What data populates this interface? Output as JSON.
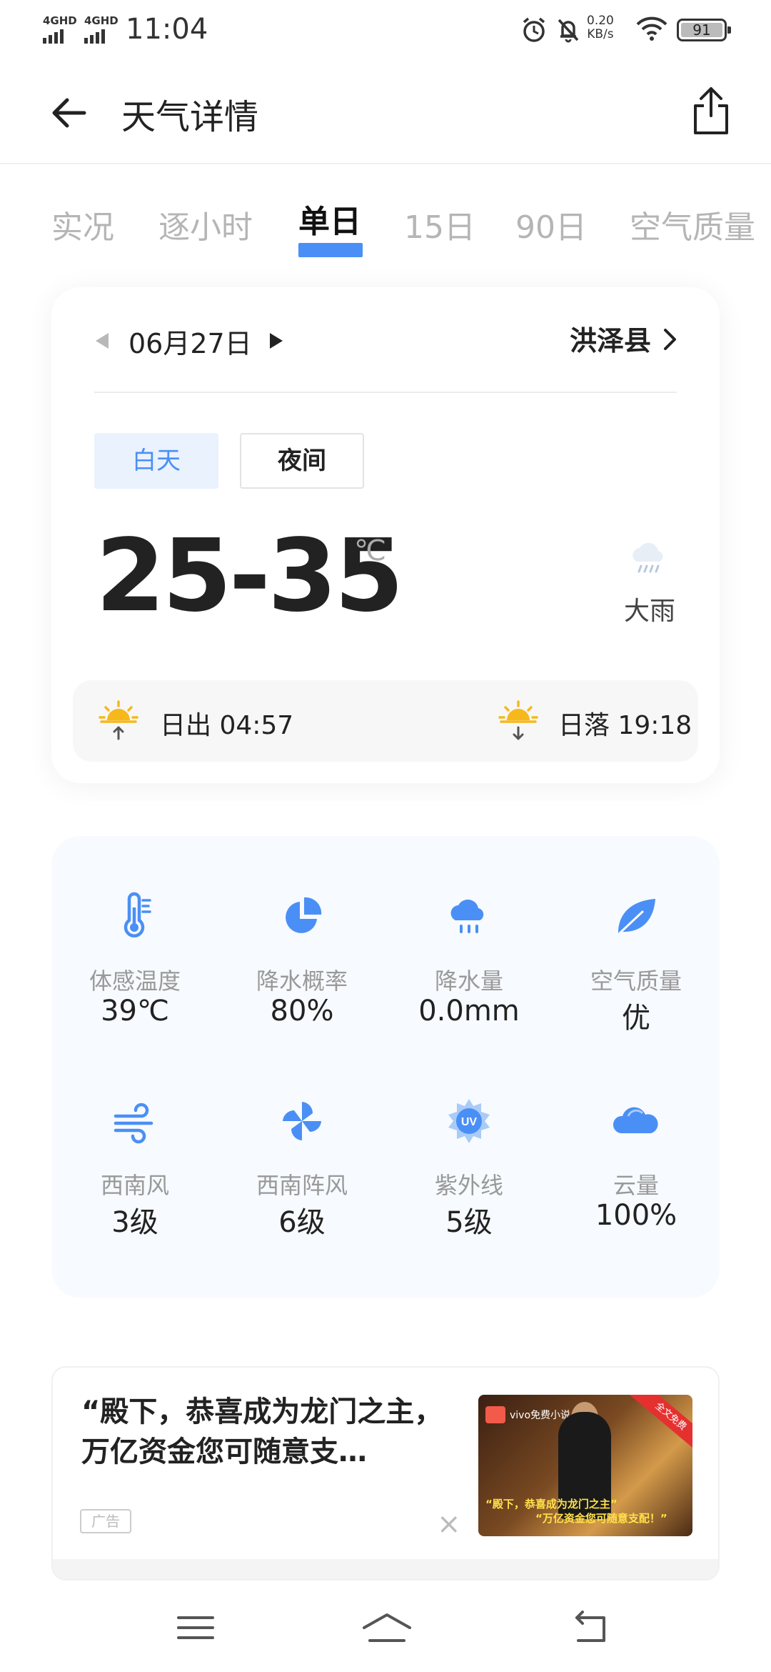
{
  "status_bar": {
    "network_1": "4GHD",
    "network_2": "4GHD",
    "time": "11:04",
    "speed_value": "0.20",
    "speed_unit": "KB/s",
    "battery": "91"
  },
  "header": {
    "title": "天气详情"
  },
  "tabs": [
    "实况",
    "逐小时",
    "单日",
    "15日",
    "90日",
    "空气质量"
  ],
  "active_tab": "单日",
  "day_card": {
    "date": "06月27日",
    "location": "洪泽县",
    "segment_day": "白天",
    "segment_night": "夜间",
    "active_segment": "白天",
    "temperature": "25-35",
    "unit": "℃",
    "weather": "大雨",
    "sunrise": "日出 04:57",
    "sunset": "日落 19:18"
  },
  "details": [
    {
      "label": "体感温度",
      "value": "39℃",
      "icon": "thermometer-icon"
    },
    {
      "label": "降水概率",
      "value": "80%",
      "icon": "pie-chart-icon"
    },
    {
      "label": "降水量",
      "value": "0.0mm",
      "icon": "rain-cloud-icon"
    },
    {
      "label": "空气质量",
      "value": "优",
      "icon": "leaf-icon"
    },
    {
      "label": "西南风",
      "value": "3级",
      "icon": "wind-icon"
    },
    {
      "label": "西南阵风",
      "value": "6级",
      "icon": "pinwheel-icon"
    },
    {
      "label": "紫外线",
      "value": "5级",
      "icon": "uv-icon"
    },
    {
      "label": "云量",
      "value": "100%",
      "icon": "cloud-icon"
    }
  ],
  "ad": {
    "text": "“殿下，恭喜成为龙门之主，万亿资金您可随意支…",
    "tag": "广告",
    "close": "×",
    "image_brand": "vivo免费小说",
    "image_ribbon": "全文免费",
    "image_caption_1": "“殿下，恭喜成为龙门之主”",
    "image_caption_2": "“万亿资金您可随意支配！”"
  },
  "colors": {
    "accent": "#4a8ff5",
    "sun": "#f7b81c",
    "icon_blue": "#4a8ff5"
  }
}
